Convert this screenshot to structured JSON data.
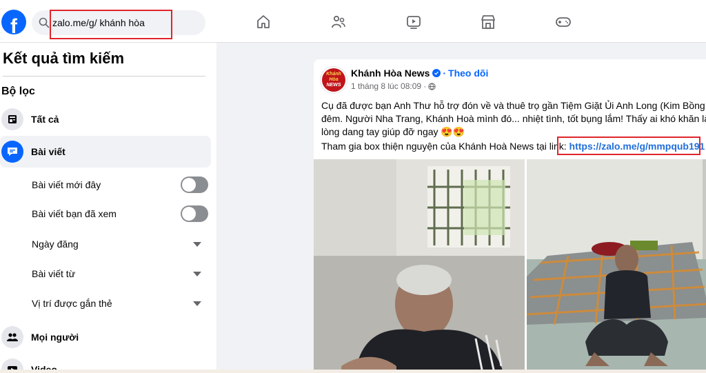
{
  "topbar": {
    "logo_letter": "f",
    "search_value": "zalo.me/g/ khánh hòa",
    "nav_icons": [
      "home-icon",
      "friends-icon",
      "video-icon",
      "marketplace-icon",
      "gaming-icon"
    ]
  },
  "sidebar": {
    "title": "Kết quả tìm kiếm",
    "filter_heading": "Bộ lọc",
    "items": [
      {
        "label": "Tất cả",
        "icon": "feed-icon"
      },
      {
        "label": "Bài viết",
        "icon": "posts-icon",
        "active": true
      }
    ],
    "sub_filters": [
      {
        "label": "Bài viết mới đây",
        "control": "toggle",
        "on": false
      },
      {
        "label": "Bài viết bạn đã xem",
        "control": "toggle",
        "on": false
      },
      {
        "label": "Ngày đăng",
        "control": "dropdown"
      },
      {
        "label": "Bài viết từ",
        "control": "dropdown"
      },
      {
        "label": "Vị trí được gắn thẻ",
        "control": "dropdown"
      }
    ],
    "more_items": [
      {
        "label": "Mọi người",
        "icon": "people-icon"
      },
      {
        "label": "Video",
        "icon": "video-icon"
      }
    ]
  },
  "post": {
    "page_name": "Khánh Hòa News",
    "follow_label": "Theo dõi",
    "timestamp": "1 tháng 8 lúc 08:09 ·",
    "avatar_text_line1": "Khánh",
    "avatar_text_line2": "Hòa",
    "avatar_text_line3": "NEWS",
    "body_line1": "Cụ đã được bạn Anh Thư hỗ trợ đón về và thuê trọ gần Tiệm Giặt Ủi Anh Long (Kim Bồng cũ)",
    "body_line2": "đêm. Người Nha Trang, Khánh Hoà mình đó... nhiệt tình, tốt bụng lắm! Thấy ai khó khăn là sẵ",
    "body_line3": "lòng dang tay giúp đỡ ngay 😍😍",
    "join_text": "Tham gia box thiện nguyện của Khánh Hoà News tại link: ",
    "join_link": "https://zalo.me/g/mmpqub191"
  },
  "colors": {
    "brand": "#0866ff",
    "highlight_box": "#e0242a",
    "link": "#216fdb"
  }
}
